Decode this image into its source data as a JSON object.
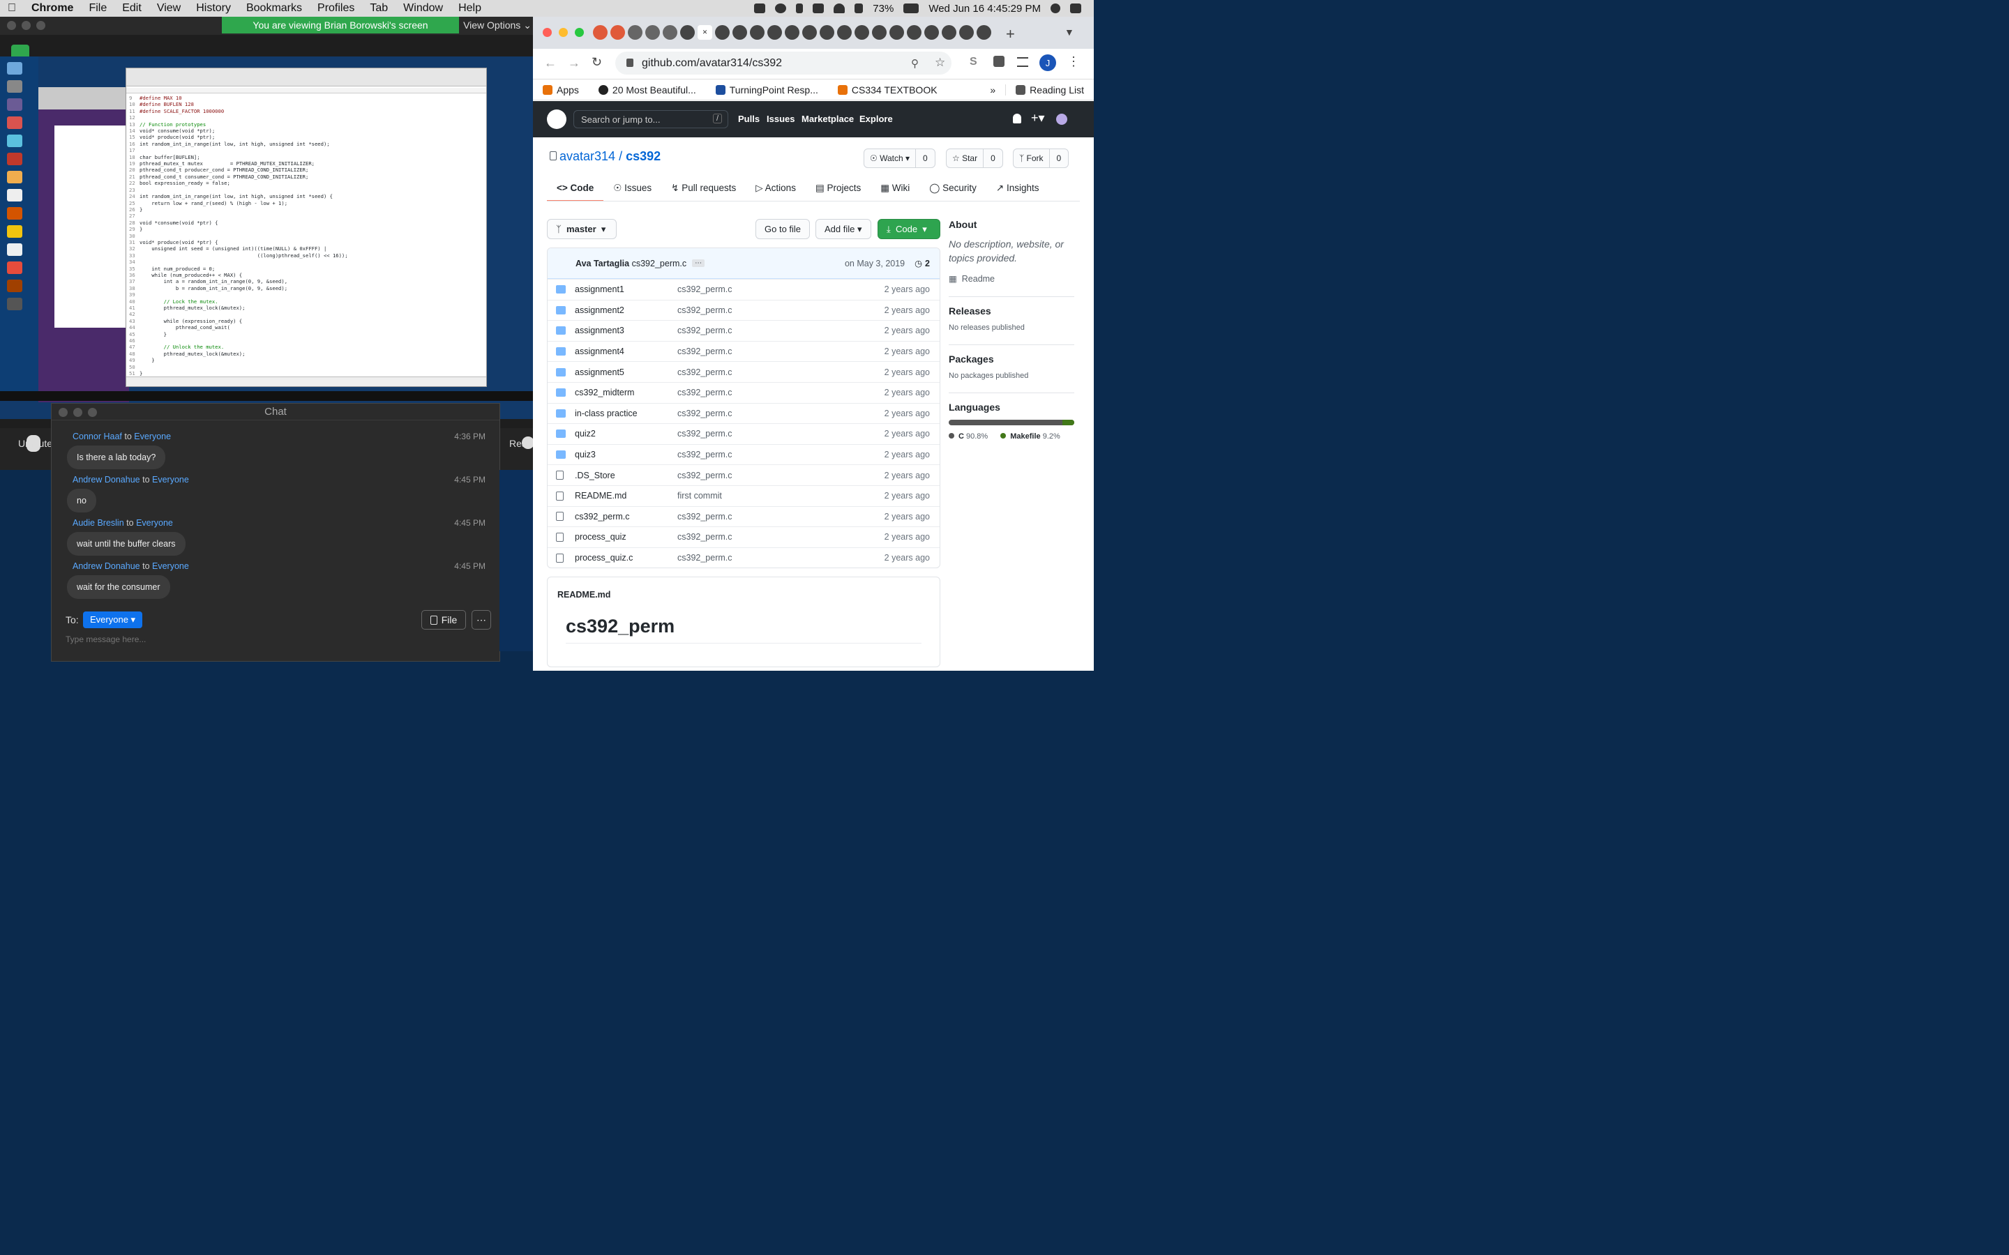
{
  "menubar": {
    "app": "Chrome",
    "items": [
      "File",
      "Edit",
      "View",
      "History",
      "Bookmarks",
      "Profiles",
      "Tab",
      "Window",
      "Help"
    ],
    "battery": "73%",
    "datetime": "Wed Jun 16  4:45:29 PM"
  },
  "zoom": {
    "banner": "You are viewing Brian Borowski's screen",
    "view_options": "View Options",
    "unmute": "Unmute",
    "react": "React"
  },
  "editor": {
    "lines": [
      {
        "n": "9",
        "t": "#define MAX 10",
        "c": "df"
      },
      {
        "n": "10",
        "t": "#define BUFLEN 128",
        "c": "df"
      },
      {
        "n": "11",
        "t": "#define SCALE_FACTOR 1000000",
        "c": "df"
      },
      {
        "n": "12",
        "t": "",
        "c": ""
      },
      {
        "n": "13",
        "t": "// Function prototypes",
        "c": "cm"
      },
      {
        "n": "14",
        "t": "void* consume(void *ptr);",
        "c": ""
      },
      {
        "n": "15",
        "t": "void* produce(void *ptr);",
        "c": ""
      },
      {
        "n": "16",
        "t": "int random_int_in_range(int low, int high, unsigned int *seed);",
        "c": ""
      },
      {
        "n": "17",
        "t": "",
        "c": ""
      },
      {
        "n": "18",
        "t": "char buffer[BUFLEN];",
        "c": ""
      },
      {
        "n": "19",
        "t": "pthread_mutex_t mutex         = PTHREAD_MUTEX_INITIALIZER;",
        "c": ""
      },
      {
        "n": "20",
        "t": "pthread_cond_t producer_cond = PTHREAD_COND_INITIALIZER;",
        "c": ""
      },
      {
        "n": "21",
        "t": "pthread_cond_t consumer_cond = PTHREAD_COND_INITIALIZER;",
        "c": ""
      },
      {
        "n": "22",
        "t": "bool expression_ready = false;",
        "c": ""
      },
      {
        "n": "23",
        "t": "",
        "c": ""
      },
      {
        "n": "24",
        "t": "int random_int_in_range(int low, int high, unsigned int *seed) {",
        "c": ""
      },
      {
        "n": "25",
        "t": "    return low + rand_r(seed) % (high - low + 1);",
        "c": ""
      },
      {
        "n": "26",
        "t": "}",
        "c": ""
      },
      {
        "n": "27",
        "t": "",
        "c": ""
      },
      {
        "n": "28",
        "t": "void *consume(void *ptr) {",
        "c": ""
      },
      {
        "n": "29",
        "t": "}",
        "c": ""
      },
      {
        "n": "30",
        "t": "",
        "c": ""
      },
      {
        "n": "31",
        "t": "void* produce(void *ptr) {",
        "c": ""
      },
      {
        "n": "32",
        "t": "    unsigned int seed = (unsigned int)((time(NULL) & 0xFFFF) |",
        "c": ""
      },
      {
        "n": "33",
        "t": "                                       ((long)pthread_self() << 16));",
        "c": ""
      },
      {
        "n": "34",
        "t": "",
        "c": ""
      },
      {
        "n": "35",
        "t": "    int num_produced = 0;",
        "c": ""
      },
      {
        "n": "36",
        "t": "    while (num_produced++ < MAX) {",
        "c": ""
      },
      {
        "n": "37",
        "t": "        int a = random_int_in_range(0, 9, &seed),",
        "c": ""
      },
      {
        "n": "38",
        "t": "            b = random_int_in_range(0, 9, &seed);",
        "c": ""
      },
      {
        "n": "39",
        "t": "",
        "c": ""
      },
      {
        "n": "40",
        "t": "        // Lock the mutex.",
        "c": "cm"
      },
      {
        "n": "41",
        "t": "        pthread_mutex_lock(&mutex);",
        "c": ""
      },
      {
        "n": "42",
        "t": "",
        "c": ""
      },
      {
        "n": "43",
        "t": "        while (expression_ready) {",
        "c": ""
      },
      {
        "n": "44",
        "t": "            pthread_cond_wait(",
        "c": ""
      },
      {
        "n": "45",
        "t": "        }",
        "c": ""
      },
      {
        "n": "46",
        "t": "",
        "c": ""
      },
      {
        "n": "47",
        "t": "        // Unlock the mutex.",
        "c": "cm"
      },
      {
        "n": "48",
        "t": "        pthread_mutex_lock(&mutex);",
        "c": ""
      },
      {
        "n": "49",
        "t": "    }",
        "c": ""
      },
      {
        "n": "50",
        "t": "",
        "c": ""
      },
      {
        "n": "51",
        "t": "}",
        "c": ""
      }
    ]
  },
  "chat": {
    "title": "Chat",
    "messages": [
      {
        "from": "Connor Haaf",
        "to": "Everyone",
        "time": "4:36 PM",
        "text": "Is there a lab today?"
      },
      {
        "from": "Andrew Donahue",
        "to": "Everyone",
        "time": "4:45 PM",
        "text": "no"
      },
      {
        "from": "Audie Breslin",
        "to": "Everyone",
        "time": "4:45 PM",
        "text": "wait until the buffer clears"
      },
      {
        "from": "Andrew Donahue",
        "to": "Everyone",
        "time": "4:45 PM",
        "text": "wait for the consumer"
      }
    ],
    "to_label": "To:",
    "to_value": "Everyone",
    "file_label": "File",
    "placeholder": "Type message here..."
  },
  "browser": {
    "url": "github.com/avatar314/cs392",
    "bookmarks": [
      "Apps",
      "20 Most Beautiful...",
      "TurningPoint Resp...",
      "CS334 TEXTBOOK"
    ],
    "reading_list": "Reading List",
    "profile_initial": "J"
  },
  "github": {
    "search_placeholder": "Search or jump to...",
    "nav": [
      "Pulls",
      "Issues",
      "Marketplace",
      "Explore"
    ],
    "owner": "avatar314",
    "repo": "cs392",
    "watch": "Watch",
    "watch_count": "0",
    "star": "Star",
    "star_count": "0",
    "fork": "Fork",
    "fork_count": "0",
    "tabs": [
      "Code",
      "Issues",
      "Pull requests",
      "Actions",
      "Projects",
      "Wiki",
      "Security",
      "Insights"
    ],
    "branch": "master",
    "go_to_file": "Go to file",
    "add_file": "Add file",
    "code_btn": "Code",
    "commit": {
      "author": "Ava Tartaglia",
      "message": "cs392_perm.c",
      "date": "on May 3, 2019",
      "count": "2"
    },
    "files": [
      {
        "name": "assignment1",
        "type": "dir",
        "msg": "cs392_perm.c",
        "age": "2 years ago"
      },
      {
        "name": "assignment2",
        "type": "dir",
        "msg": "cs392_perm.c",
        "age": "2 years ago"
      },
      {
        "name": "assignment3",
        "type": "dir",
        "msg": "cs392_perm.c",
        "age": "2 years ago"
      },
      {
        "name": "assignment4",
        "type": "dir",
        "msg": "cs392_perm.c",
        "age": "2 years ago"
      },
      {
        "name": "assignment5",
        "type": "dir",
        "msg": "cs392_perm.c",
        "age": "2 years ago"
      },
      {
        "name": "cs392_midterm",
        "type": "dir",
        "msg": "cs392_perm.c",
        "age": "2 years ago"
      },
      {
        "name": "in-class practice",
        "type": "dir",
        "msg": "cs392_perm.c",
        "age": "2 years ago"
      },
      {
        "name": "quiz2",
        "type": "dir",
        "msg": "cs392_perm.c",
        "age": "2 years ago"
      },
      {
        "name": "quiz3",
        "type": "dir",
        "msg": "cs392_perm.c",
        "age": "2 years ago"
      },
      {
        "name": ".DS_Store",
        "type": "file",
        "msg": "cs392_perm.c",
        "age": "2 years ago"
      },
      {
        "name": "README.md",
        "type": "file",
        "msg": "first commit",
        "age": "2 years ago"
      },
      {
        "name": "cs392_perm.c",
        "type": "file",
        "msg": "cs392_perm.c",
        "age": "2 years ago"
      },
      {
        "name": "process_quiz",
        "type": "file",
        "msg": "cs392_perm.c",
        "age": "2 years ago"
      },
      {
        "name": "process_quiz.c",
        "type": "file",
        "msg": "cs392_perm.c",
        "age": "2 years ago"
      }
    ],
    "readme_label": "README.md",
    "readme_title": "cs392_perm",
    "about": {
      "heading": "About",
      "text": "No description, website, or topics provided.",
      "readme": "Readme"
    },
    "releases": {
      "heading": "Releases",
      "text": "No releases published"
    },
    "packages": {
      "heading": "Packages",
      "text": "No packages published"
    },
    "languages": {
      "heading": "Languages",
      "items": [
        {
          "name": "C",
          "pct": "90.8%",
          "value": 90.8,
          "color": "#555555"
        },
        {
          "name": "Makefile",
          "pct": "9.2%",
          "value": 9.2,
          "color": "#427819"
        }
      ]
    }
  }
}
